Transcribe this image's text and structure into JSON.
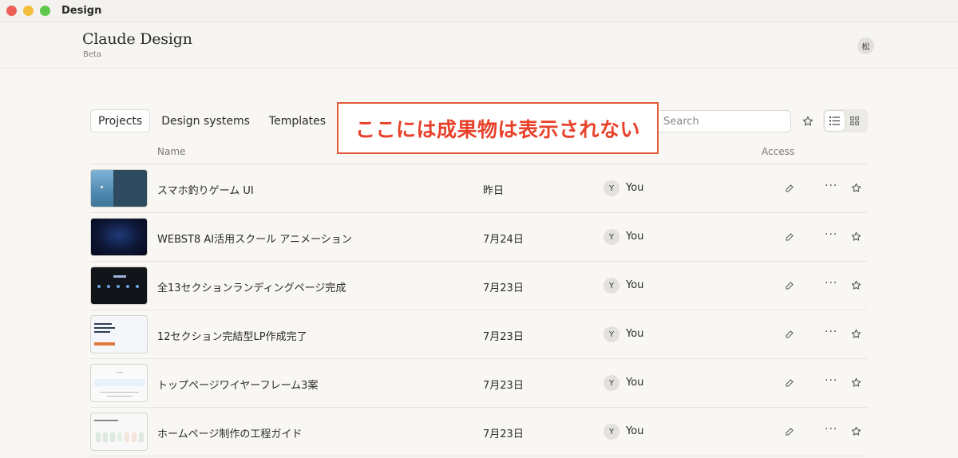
{
  "window": {
    "title": "Design"
  },
  "app": {
    "name": "Claude Design",
    "badge": "Beta",
    "user_initial": "松"
  },
  "tabs": [
    {
      "label": "Projects",
      "active": true
    },
    {
      "label": "Design systems",
      "active": false
    },
    {
      "label": "Templates",
      "active": false
    }
  ],
  "search": {
    "placeholder": "Search",
    "value": ""
  },
  "columns": {
    "name": "Name",
    "viewed": "",
    "owner": "",
    "access": "Access"
  },
  "annotation": {
    "text": "ここには成果物は表示されない",
    "color": "#e8412a"
  },
  "projects": [
    {
      "name": "スマホ釣りゲーム UI",
      "date": "昨日",
      "owner_initial": "Y",
      "owner": "You"
    },
    {
      "name": "WEBST8 AI活用スクール アニメーション",
      "date": "7月24日",
      "owner_initial": "Y",
      "owner": "You"
    },
    {
      "name": "全13セクションランディングページ完成",
      "date": "7月23日",
      "owner_initial": "Y",
      "owner": "You"
    },
    {
      "name": "12セクション完結型LP作成完了",
      "date": "7月23日",
      "owner_initial": "Y",
      "owner": "You"
    },
    {
      "name": "トップページワイヤーフレーム3案",
      "date": "7月23日",
      "owner_initial": "Y",
      "owner": "You"
    },
    {
      "name": "ホームページ制作の工程ガイド",
      "date": "7月23日",
      "owner_initial": "Y",
      "owner": "You"
    }
  ],
  "icons": {
    "access": "pencil-icon",
    "more": "more-horizontal-icon",
    "favorite": "star-icon",
    "list_view": "list-view-icon",
    "grid_view": "grid-view-icon"
  }
}
